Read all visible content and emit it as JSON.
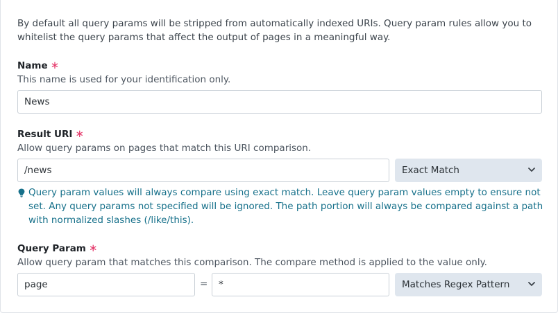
{
  "intro": "By default all query params will be stripped from automatically indexed URIs. Query param rules allow you to whitelist the query params that affect the output of pages in a meaningful way.",
  "name": {
    "label": "Name",
    "required": "∗",
    "help": "This name is used for your identification only.",
    "value": "News"
  },
  "result_uri": {
    "label": "Result URI",
    "required": "∗",
    "help": "Allow query params on pages that match this URI comparison.",
    "value": "/news",
    "match": "Exact Match",
    "note": "Query param values will always compare using exact match. Leave query param values empty to ensure not set. Any query params not specified will be ignored. The path portion will always be compared against a path with normalized slashes (/like/this)."
  },
  "query_param": {
    "label": "Query Param",
    "required": "∗",
    "help": "Allow query param that matches this comparison. The compare method is applied to the value only.",
    "key": "page",
    "equals": "=",
    "value": "*",
    "match": "Matches Regex Pattern"
  },
  "colors": {
    "required": "#e5396b",
    "note": "#16708a",
    "select_bg": "#dfe6ee",
    "border": "#c8cfd6"
  },
  "icons": [
    "chevron-down-icon",
    "lightbulb-icon"
  ]
}
